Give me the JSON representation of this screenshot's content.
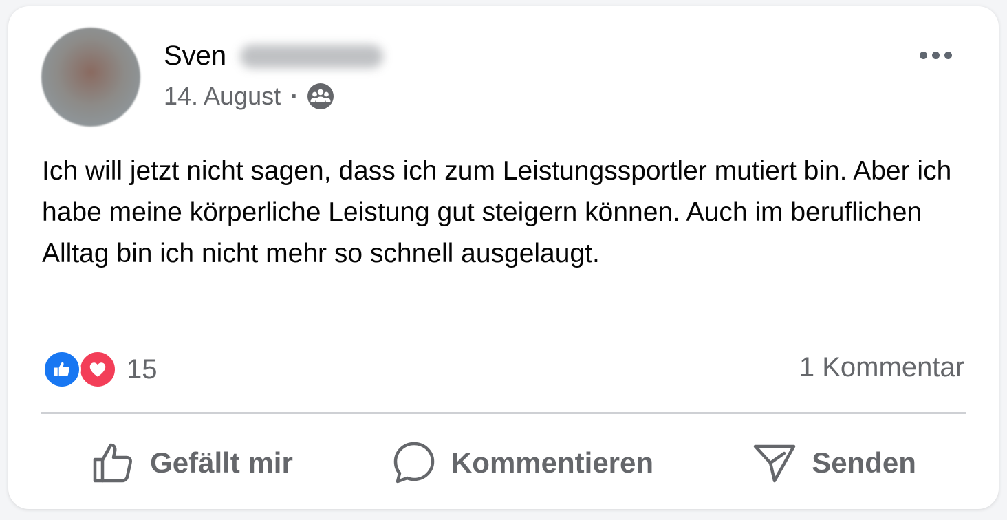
{
  "post": {
    "author_first_name": "Sven",
    "date": "14. August",
    "separator": "·",
    "audience_icon": "group-audience-icon",
    "text": "Ich will jetzt nicht sagen, dass ich zum Leistungssportler mutiert bin. Aber ich habe meine körperliche Leistung gut steigern können. Auch im beruflichen Alltag bin ich nicht mehr so schnell ausgelaugt."
  },
  "reactions": {
    "types": [
      "like",
      "love"
    ],
    "count": "15"
  },
  "comments": {
    "label": "1 Kommentar"
  },
  "actions": {
    "like_label": "Gefällt mir",
    "comment_label": "Kommentieren",
    "send_label": "Senden"
  },
  "colors": {
    "like_blue": "#1877f2",
    "love_red": "#f33e58",
    "secondary_text": "#65676b",
    "primary_text": "#050505"
  }
}
